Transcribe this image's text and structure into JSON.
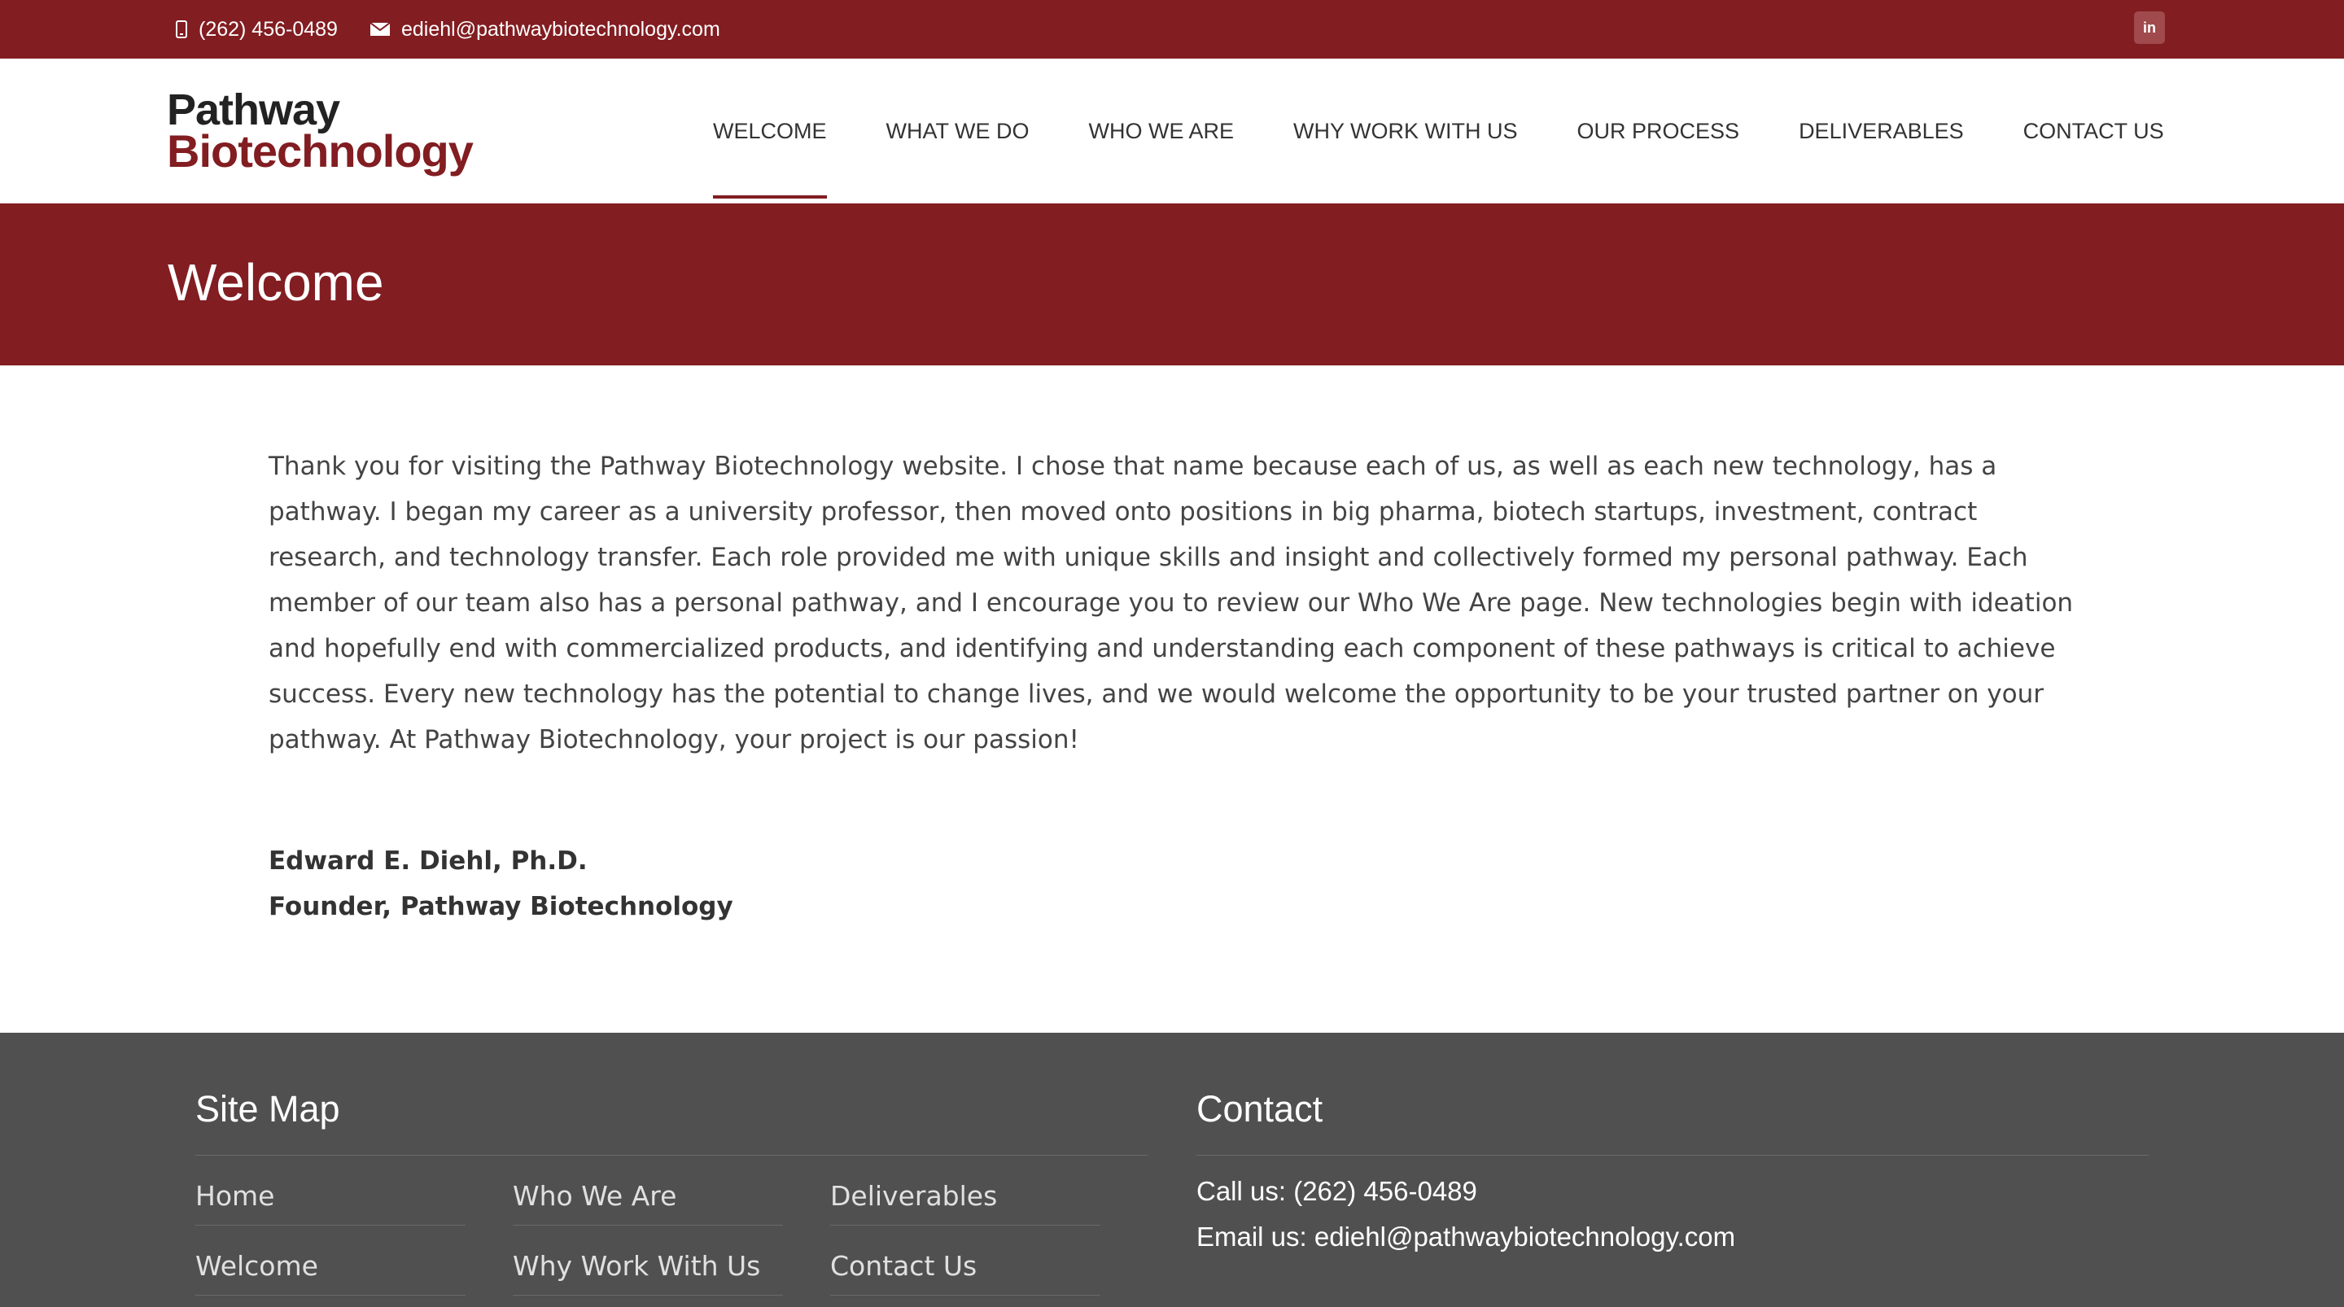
{
  "topbar": {
    "phone": "(262) 456-0489",
    "email": "ediehl@pathwaybiotechnology.com",
    "social_label": "in"
  },
  "logo": {
    "line1": "Pathway",
    "line2": "Biotechnology"
  },
  "nav": {
    "items": [
      {
        "label": "WELCOME"
      },
      {
        "label": "WHAT WE DO"
      },
      {
        "label": "WHO WE ARE"
      },
      {
        "label": "WHY WORK WITH US"
      },
      {
        "label": "OUR PROCESS"
      },
      {
        "label": "DELIVERABLES"
      },
      {
        "label": "CONTACT US"
      }
    ]
  },
  "banner": {
    "title": "Welcome"
  },
  "content": {
    "body": "Thank you for visiting the Pathway Biotechnology website. I chose that name because each of us, as well as each new technology, has a pathway. I began my career as a university professor, then moved onto positions in big pharma, biotech startups, investment, contract research, and technology transfer. Each role provided me with unique skills and insight and collectively formed my personal pathway. Each member of our team also has a personal pathway, and I encourage you to review our Who We Are page. New technologies begin with ideation and hopefully end with commercialized products, and identifying and understanding each component of these pathways is critical to achieve success. Every new technology has the potential to change lives, and we would welcome the opportunity to be your trusted partner on your pathway. At Pathway Biotechnology, your project is our passion!",
    "signature_name": "Edward E. Diehl, Ph.D.",
    "signature_title": "Founder, Pathway Biotechnology"
  },
  "footer": {
    "sitemap_title": "Site Map",
    "sitemap": [
      [
        "Home",
        "Welcome"
      ],
      [
        "Who We Are",
        "Why Work With Us"
      ],
      [
        "Deliverables",
        "Contact Us"
      ]
    ],
    "contact_title": "Contact",
    "call": "Call us: (262) 456-0489",
    "email": "Email us: ediehl@pathwaybiotechnology.com"
  },
  "colors": {
    "brand": "#821d21",
    "footer_bg": "#505050"
  }
}
